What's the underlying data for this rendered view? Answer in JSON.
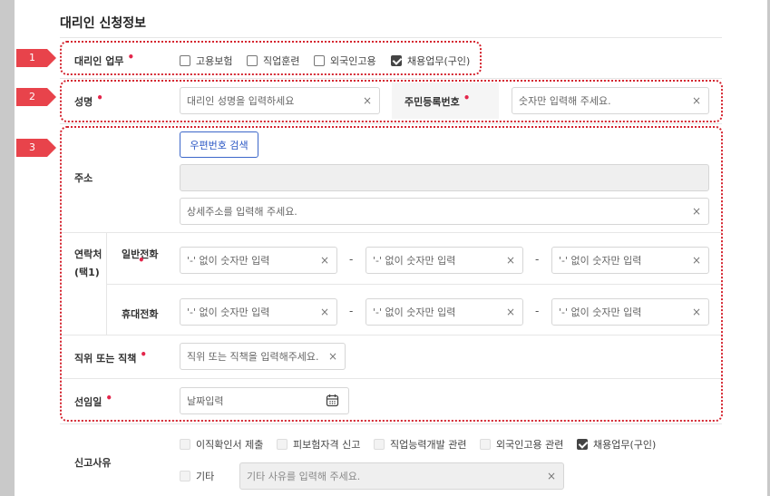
{
  "title": "대리인 신청정보",
  "markers": [
    "1",
    "2",
    "3"
  ],
  "work": {
    "label": "대리인 업무",
    "options": [
      {
        "label": "고용보험",
        "checked": false
      },
      {
        "label": "직업훈련",
        "checked": false
      },
      {
        "label": "외국인고용",
        "checked": false
      },
      {
        "label": "채용업무(구인)",
        "checked": true
      }
    ]
  },
  "name": {
    "label": "성명",
    "placeholder": "대리인 성명을 입력하세요"
  },
  "rrn": {
    "label": "주민등록번호",
    "placeholder": "숫자만 입력해 주세요."
  },
  "address": {
    "label": "주소",
    "zip_button": "우편번호 검색",
    "detail_placeholder": "상세주소를 입력해 주세요."
  },
  "contact": {
    "label_line1": "연락처",
    "label_line2": "(택1)",
    "phone_label": "일반전화",
    "mobile_label": "휴대전화",
    "placeholder": "'-' 없이 숫자만 입력",
    "sep": "-"
  },
  "position": {
    "label": "직위 또는 직책",
    "placeholder": "직위 또는 직책을 입력해주세요."
  },
  "start_date": {
    "label": "선임일",
    "placeholder": "날짜입력"
  },
  "reason": {
    "label": "신고사유",
    "options": [
      {
        "label": "이직확인서 제출",
        "checked": false
      },
      {
        "label": "피보험자격 신고",
        "checked": false
      },
      {
        "label": "직업능력개발 관련",
        "checked": false
      },
      {
        "label": "외국인고용 관련",
        "checked": false
      },
      {
        "label": "채용업무(구인)",
        "checked": true
      }
    ],
    "other_label": "기타",
    "other_placeholder": "기타 사유를 입력해 주세요."
  },
  "clear_icon": "×",
  "colors": {
    "accent": "#2b57c4",
    "highlight": "#d4242f",
    "marker": "#e8434b"
  }
}
